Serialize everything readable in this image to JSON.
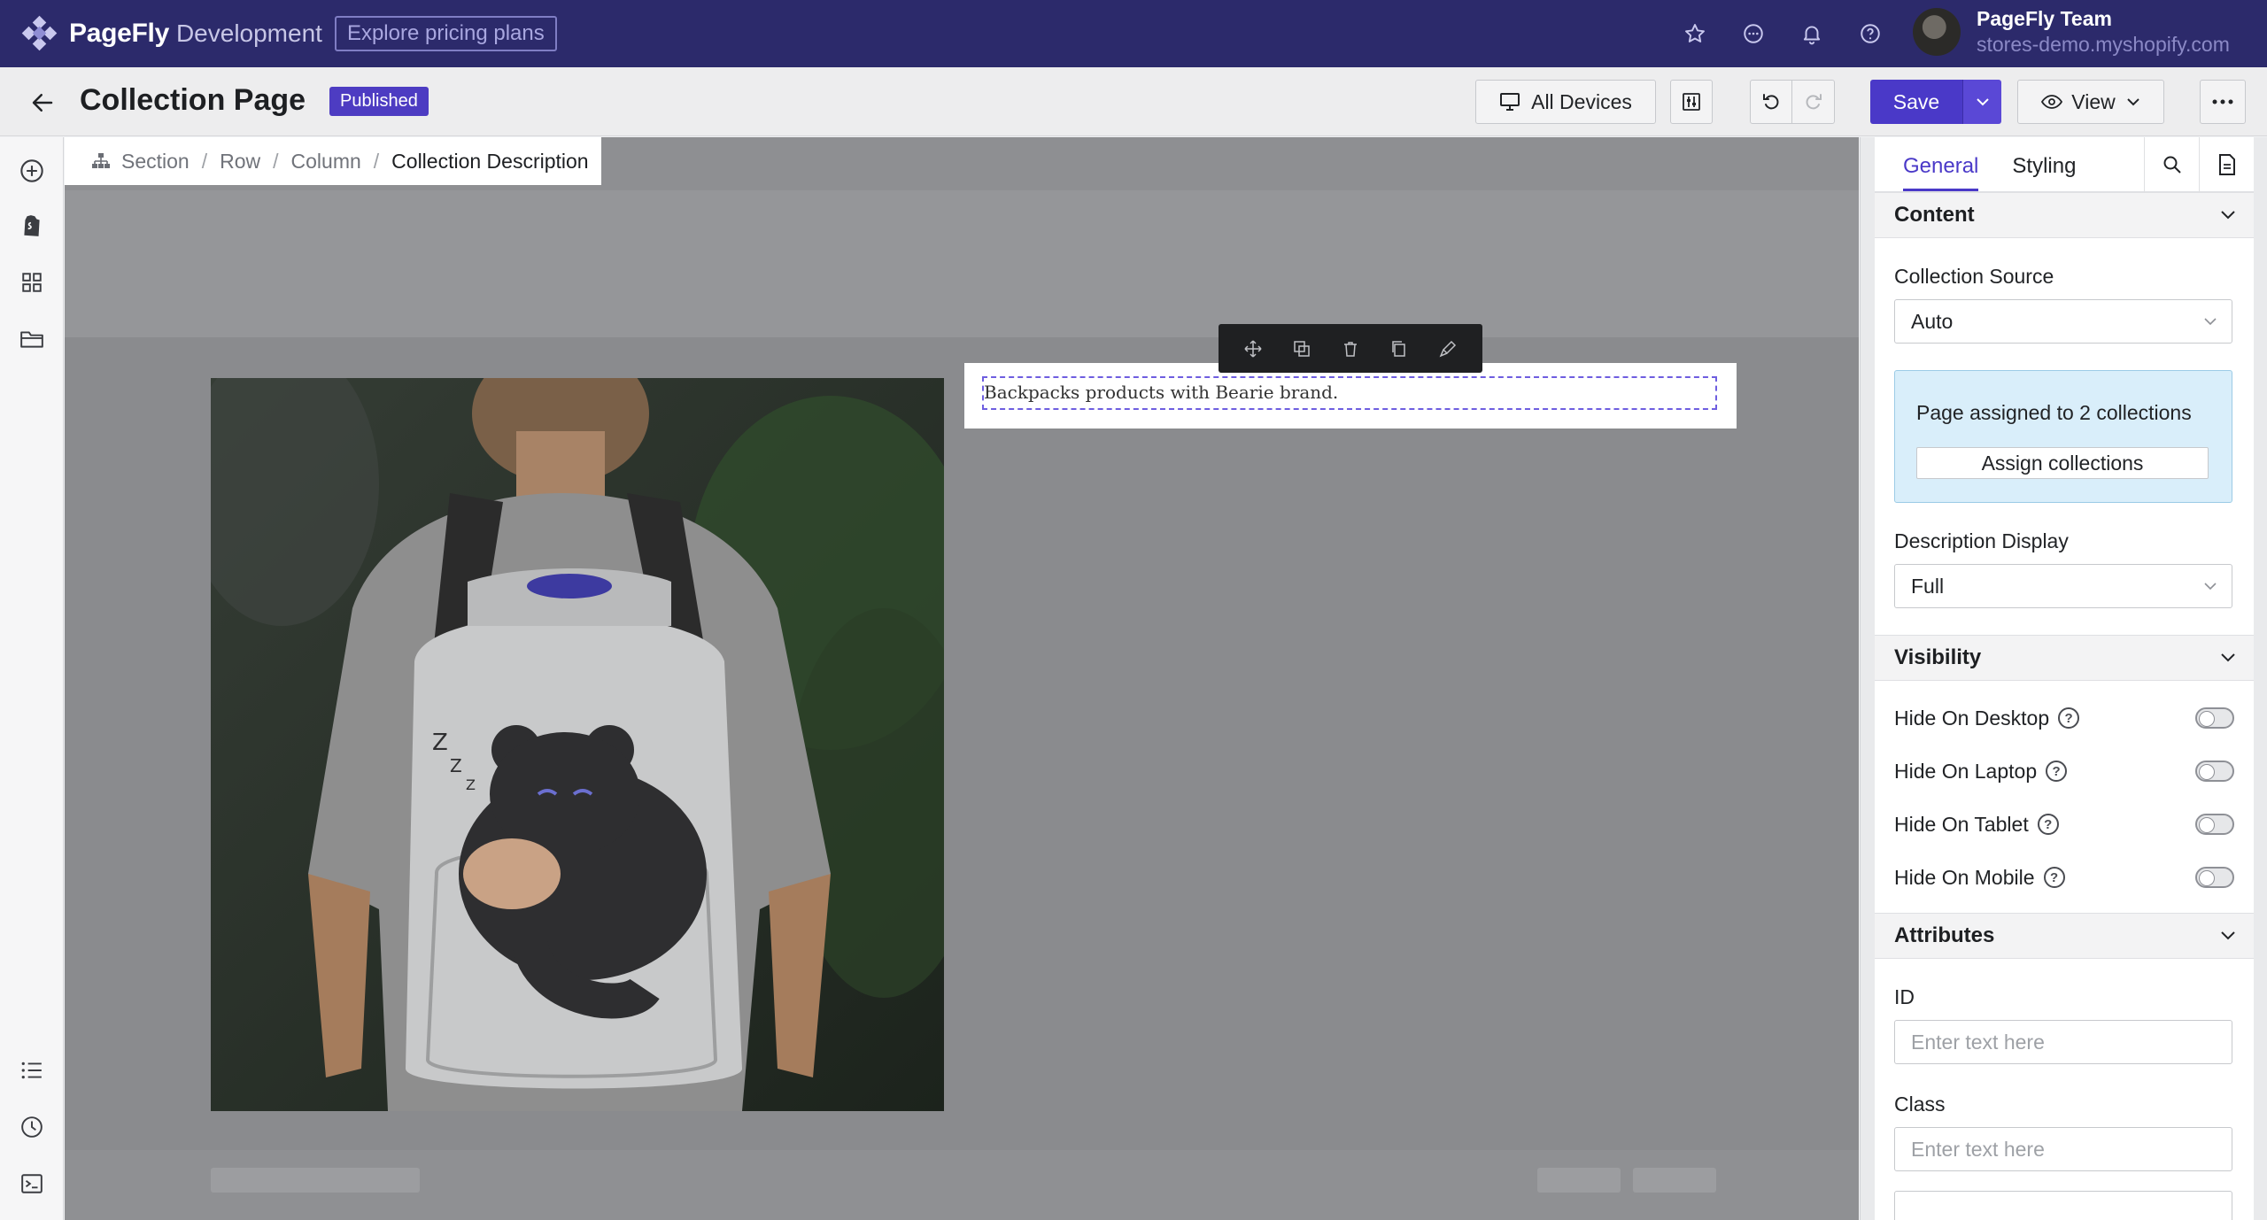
{
  "topnav": {
    "brand_name": "PageFly",
    "brand_env": "Development",
    "pricing_label": "Explore pricing plans",
    "user_name": "PageFly Team",
    "user_store": "stores-demo.myshopify.com"
  },
  "header": {
    "title": "Collection Page",
    "status": "Published",
    "devices_label": "All Devices",
    "save_label": "Save",
    "view_label": "View"
  },
  "breadcrumb": {
    "items": [
      "Section",
      "Row",
      "Column"
    ],
    "current": "Collection Description"
  },
  "canvas": {
    "description_text": "Backpacks products with Bearie brand."
  },
  "panel": {
    "tabs": [
      "General",
      "Styling"
    ],
    "content": {
      "title": "Content",
      "collection_source_label": "Collection Source",
      "collection_source_value": "Auto",
      "assigned_text": "Page assigned to 2 collections",
      "assign_button": "Assign collections",
      "description_display_label": "Description Display",
      "description_display_value": "Full"
    },
    "visibility": {
      "title": "Visibility",
      "items": [
        "Hide On Desktop",
        "Hide On Laptop",
        "Hide On Tablet",
        "Hide On Mobile"
      ]
    },
    "attributes": {
      "title": "Attributes",
      "id_label": "ID",
      "id_placeholder": "Enter text here",
      "class_label": "Class",
      "class_placeholder": "Enter text here"
    }
  },
  "colors": {
    "nav_bg": "#2c2a6b",
    "accent": "#4a39c8",
    "info_bg": "#d9eefa"
  }
}
